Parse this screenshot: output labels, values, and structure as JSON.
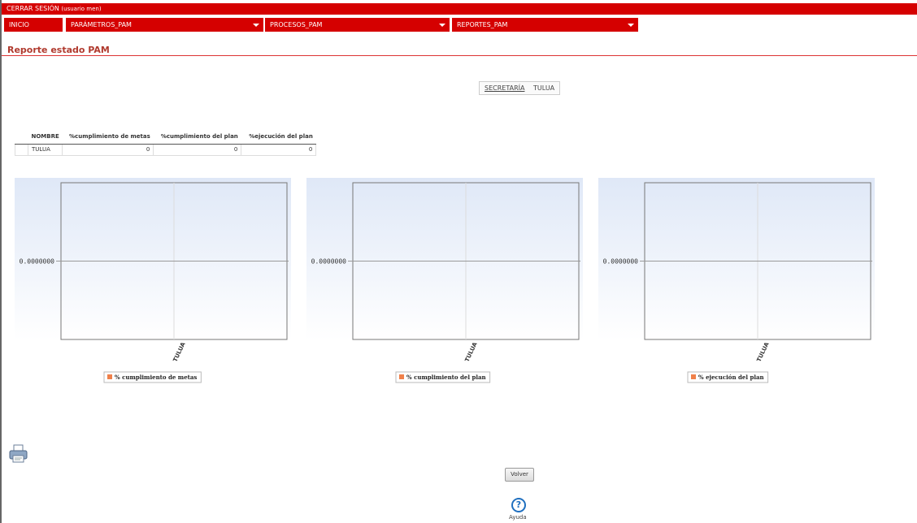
{
  "header": {
    "logout_label": "CERRAR SESIÓN",
    "user_label": "(usuario men)"
  },
  "menu": {
    "items": [
      {
        "label": "INICIO",
        "has_dropdown": false
      },
      {
        "label": "PARÁMETROS_PAM",
        "has_dropdown": true
      },
      {
        "label": "PROCESOS_PAM",
        "has_dropdown": true
      },
      {
        "label": "REPORTES_PAM",
        "has_dropdown": true
      }
    ]
  },
  "page": {
    "title": "Reporte estado PAM"
  },
  "breadcrumb": {
    "link_label": "SECRETARÍA",
    "current_label": "TULUA"
  },
  "table": {
    "headers": [
      "NOMBRE",
      "%cumplimiento de metas",
      "%cumplimiento del plan",
      "%ejecución del plan"
    ],
    "rows": [
      {
        "name": "TULUA",
        "metas": "0",
        "plan": "0",
        "ejecucion": "0"
      }
    ]
  },
  "chart_data": [
    {
      "type": "bar",
      "categories": [
        "TULUA"
      ],
      "series": [
        {
          "name": "% cumplimiento de metas",
          "values": [
            0
          ]
        }
      ],
      "y_tick_label": "0.0000000",
      "grid": true,
      "legend_position": "bottom"
    },
    {
      "type": "bar",
      "categories": [
        "TULUA"
      ],
      "series": [
        {
          "name": "% cumplimiento del plan",
          "values": [
            0
          ]
        }
      ],
      "y_tick_label": "0.0000000",
      "grid": true,
      "legend_position": "bottom"
    },
    {
      "type": "bar",
      "categories": [
        "TULUA"
      ],
      "series": [
        {
          "name": "% ejecución del plan",
          "values": [
            0
          ]
        }
      ],
      "y_tick_label": "0.0000000",
      "grid": true,
      "legend_position": "bottom"
    }
  ],
  "colors": {
    "brand_red": "#d50000",
    "title_red": "#b03a2e",
    "series_orange": "#f0804a",
    "help_blue": "#1f6fbf"
  },
  "footer": {
    "print_icon": "printer-icon",
    "back_label": "Volver",
    "help_icon": "help-icon",
    "help_label": "Ayuda"
  }
}
